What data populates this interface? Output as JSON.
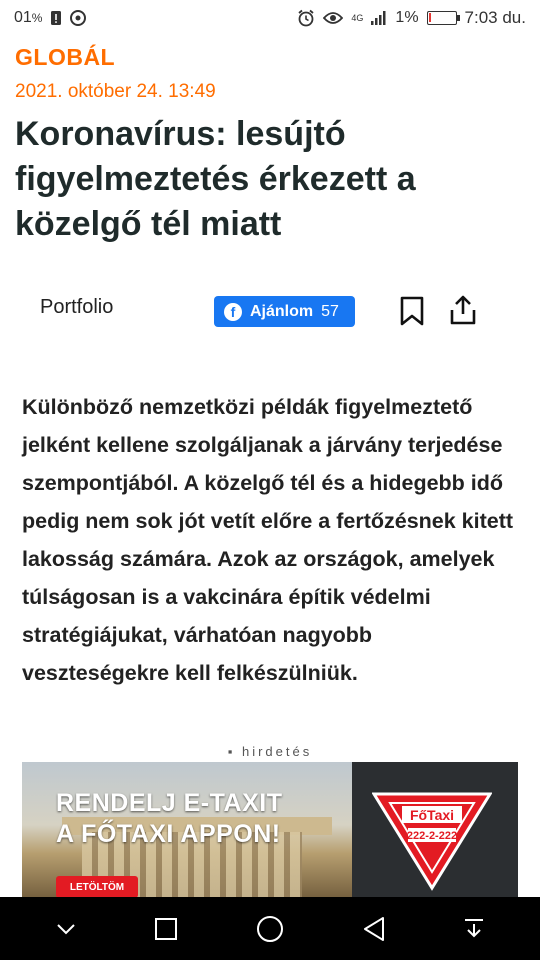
{
  "status_bar": {
    "left_text": "01",
    "left_sub": "%",
    "battery_percent": "1%",
    "network": "4G",
    "time": "7:03 du.",
    "battery_level": 0.01
  },
  "article": {
    "section": "GLOBÁL",
    "date": "2021. október 24. 13:49",
    "title": "Koronavírus: lesújtó figyelmeztetés érkezett a közelgő tél miatt",
    "source": "Portfolio",
    "like_label": "Ajánlom",
    "like_count": "57",
    "lead": "Különböző nemzetközi példák figyelmeztető jelként kellene szolgáljanak a járvány terjedése szempontjából. A közelgő tél és a hidegebb idő pedig nem sok jót vetít előre a fertőzésnek kitett lakosság számára. Azok az országok, amelyek túlságosan is a vakcinára építik védelmi stratégiájukat, várhatóan nagyobb veszteségekre kell felkészülniük."
  },
  "ad": {
    "label": "hirdetés",
    "headline_line1": "RENDELJ E-TAXIT",
    "headline_line2": "A FŐTAXI APPON!",
    "download_label": "LETÖLTÖM",
    "logo_text": "FőTaxi",
    "phone": "222-2-222"
  },
  "icons": {
    "facebook": "facebook-icon",
    "bookmark": "bookmark-icon",
    "share": "share-icon",
    "nav": [
      "chevron-down-icon",
      "square-icon",
      "circle-icon",
      "triangle-back-icon",
      "download-icon"
    ]
  },
  "colors": {
    "accent": "#ff6d00",
    "facebook": "#1877f2",
    "ad_red": "#e31b23"
  }
}
